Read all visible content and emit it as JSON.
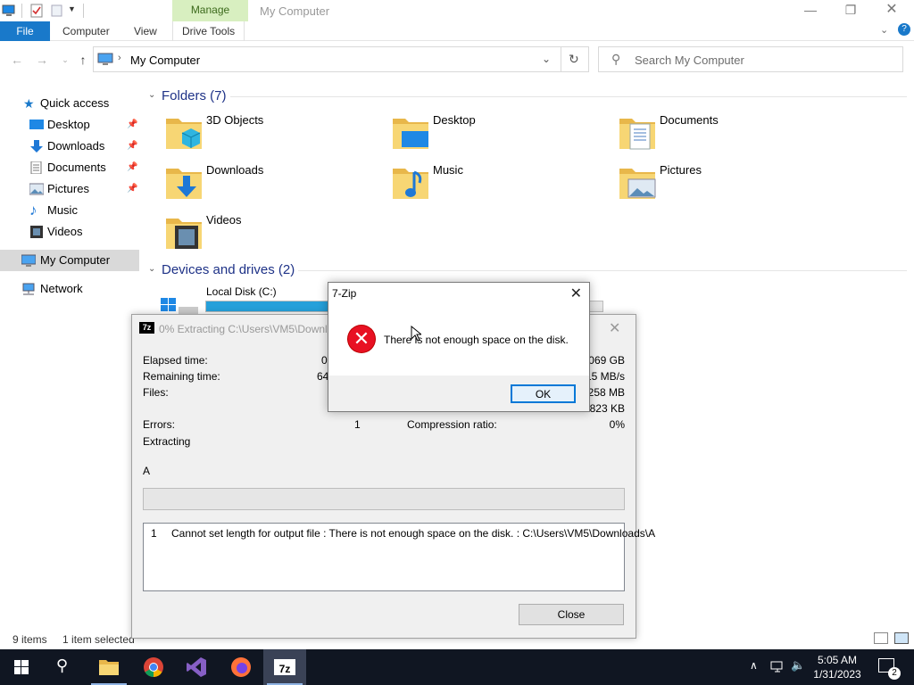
{
  "titlebar": {
    "context_tab": "Manage",
    "title": "My Computer",
    "minimize": "—",
    "restore": "❐",
    "close": "✕"
  },
  "ribbon": {
    "file": "File",
    "tabs": [
      "Computer",
      "View",
      "Drive Tools"
    ]
  },
  "address": {
    "path": "My Computer",
    "search_placeholder": "Search My Computer"
  },
  "sidebar": {
    "quick_access": "Quick access",
    "items": [
      {
        "label": "Desktop",
        "icon": "desktop-icon",
        "pinned": true
      },
      {
        "label": "Downloads",
        "icon": "download-icon",
        "pinned": true
      },
      {
        "label": "Documents",
        "icon": "document-icon",
        "pinned": true
      },
      {
        "label": "Pictures",
        "icon": "pictures-icon",
        "pinned": true
      },
      {
        "label": "Music",
        "icon": "music-icon",
        "pinned": false
      },
      {
        "label": "Videos",
        "icon": "videos-icon",
        "pinned": false
      }
    ],
    "this_pc": "My Computer",
    "network": "Network"
  },
  "content": {
    "folders_header": "Folders (7)",
    "folders": [
      "3D Objects",
      "Desktop",
      "Documents",
      "Downloads",
      "Music",
      "Pictures",
      "Videos"
    ],
    "devices_header": "Devices and drives (2)",
    "drives": [
      {
        "label": "Local Disk (C:)",
        "used_fraction": 0.5
      }
    ]
  },
  "status": {
    "items": "9 items",
    "selected": "1 item selected"
  },
  "progress_window": {
    "title": "0% Extracting C:\\Users\\VM5\\Downlo",
    "elapsed_label": "Elapsed time:",
    "elapsed_value": "0",
    "remaining_label": "Remaining time:",
    "remaining_value": "64",
    "files_label": "Files:",
    "errors_label": "Errors:",
    "errors_value": "1",
    "compression_label": "Compression ratio:",
    "compression_value": "0%",
    "right_values": [
      "2069 GB",
      "15 MB/s",
      "1258 MB",
      "6823 KB"
    ],
    "status_text": "Extracting",
    "current_file": "A",
    "progress_fraction": 0,
    "error_index": "1",
    "error_message": "Cannot set length for output file : There is not enough space on the disk. : C:\\Users\\VM5\\Downloads\\A",
    "close_button": "Close"
  },
  "error_dialog": {
    "title": "7-Zip",
    "message": "There is not enough space on the disk.",
    "ok_button": "OK"
  },
  "taskbar": {
    "time": "5:05 AM",
    "date": "1/31/2023",
    "notification_count": "2"
  }
}
